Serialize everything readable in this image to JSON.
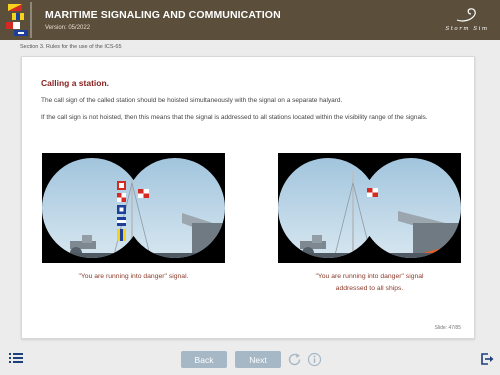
{
  "header": {
    "title": "MARITIME SIGNALING AND COMMUNICATION",
    "version": "Version: 05/2022",
    "brand": "Storm Sim"
  },
  "section": "Section 3. Rules for the use of the ICS-65",
  "slide": {
    "heading": "Calling a station.",
    "paragraph1": "The call sign of the called station should be hoisted simultaneously with the signal on a separate halyard.",
    "paragraph2": "If the call sign is not hoisted, then this means that the signal is addressed to all stations located within the visibility range of the signals.",
    "caption_left": "\"You are running into danger\" signal.",
    "caption_right_line1": "\"You are running into danger\" signal",
    "caption_right_line2": "addressed to all ships.",
    "counter": "Slide: 47/85"
  },
  "nav": {
    "back_label": "Back",
    "next_label": "Next"
  },
  "icons": {
    "toc": "list-icon",
    "reload": "reload-icon",
    "info": "info-icon",
    "exit": "exit-icon"
  },
  "colors": {
    "header_bg": "#5b4f3c",
    "heading": "#8a2020",
    "caption": "#8a3a2a",
    "nav_button": "#a6b7c6"
  }
}
